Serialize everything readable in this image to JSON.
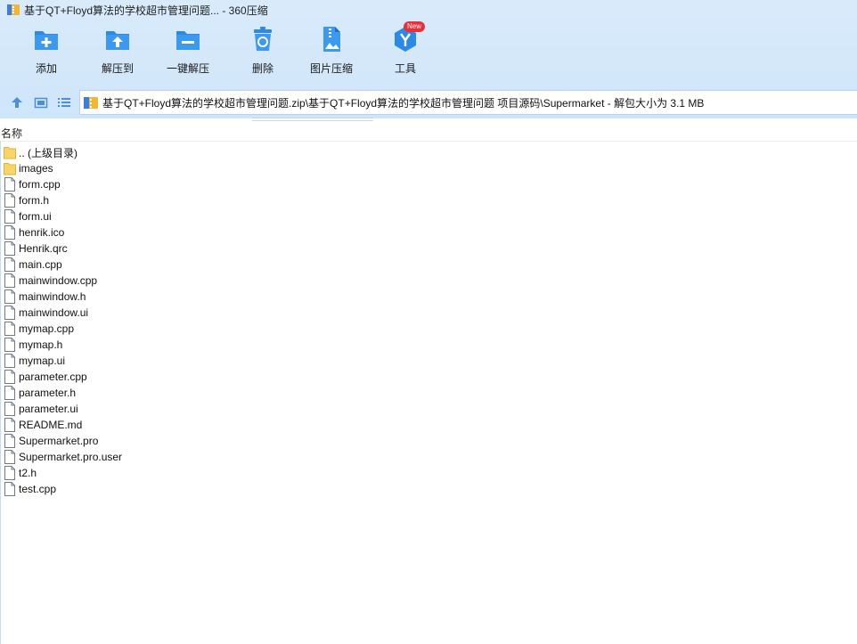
{
  "window": {
    "title": "基于QT+Floyd算法的学校超市管理问题... - 360压缩"
  },
  "toolbar": {
    "items": [
      {
        "label": "添加",
        "icon": "add-icon"
      },
      {
        "label": "解压到",
        "icon": "extract-to-icon"
      },
      {
        "label": "一键解压",
        "icon": "one-click-extract-icon"
      },
      {
        "label": "删除",
        "icon": "delete-icon"
      },
      {
        "label": "图片压缩",
        "icon": "image-compress-icon"
      },
      {
        "label": "工具",
        "icon": "tools-icon",
        "badge": "New"
      }
    ]
  },
  "address": {
    "path": "基于QT+Floyd算法的学校超市管理问题.zip\\基于QT+Floyd算法的学校超市管理问题 项目源码\\Supermarket - 解包大小为 3.1 MB"
  },
  "columns": {
    "name": "名称"
  },
  "files": [
    {
      "name": ".. (上级目录)",
      "type": "folder"
    },
    {
      "name": "images",
      "type": "folder"
    },
    {
      "name": "form.cpp",
      "type": "file"
    },
    {
      "name": "form.h",
      "type": "file"
    },
    {
      "name": "form.ui",
      "type": "file"
    },
    {
      "name": "henrik.ico",
      "type": "file"
    },
    {
      "name": "Henrik.qrc",
      "type": "file"
    },
    {
      "name": "main.cpp",
      "type": "file"
    },
    {
      "name": "mainwindow.cpp",
      "type": "file"
    },
    {
      "name": "mainwindow.h",
      "type": "file"
    },
    {
      "name": "mainwindow.ui",
      "type": "file"
    },
    {
      "name": "mymap.cpp",
      "type": "file"
    },
    {
      "name": "mymap.h",
      "type": "file"
    },
    {
      "name": "mymap.ui",
      "type": "file"
    },
    {
      "name": "parameter.cpp",
      "type": "file"
    },
    {
      "name": "parameter.h",
      "type": "file"
    },
    {
      "name": "parameter.ui",
      "type": "file"
    },
    {
      "name": "README.md",
      "type": "file"
    },
    {
      "name": "Supermarket.pro",
      "type": "file"
    },
    {
      "name": "Supermarket.pro.user",
      "type": "file"
    },
    {
      "name": "t2.h",
      "type": "file"
    },
    {
      "name": "test.cpp",
      "type": "file"
    }
  ],
  "colors": {
    "accent": "#2a8ae6",
    "folder": "#f7d56a",
    "header_bg": "#d9ebfb"
  }
}
